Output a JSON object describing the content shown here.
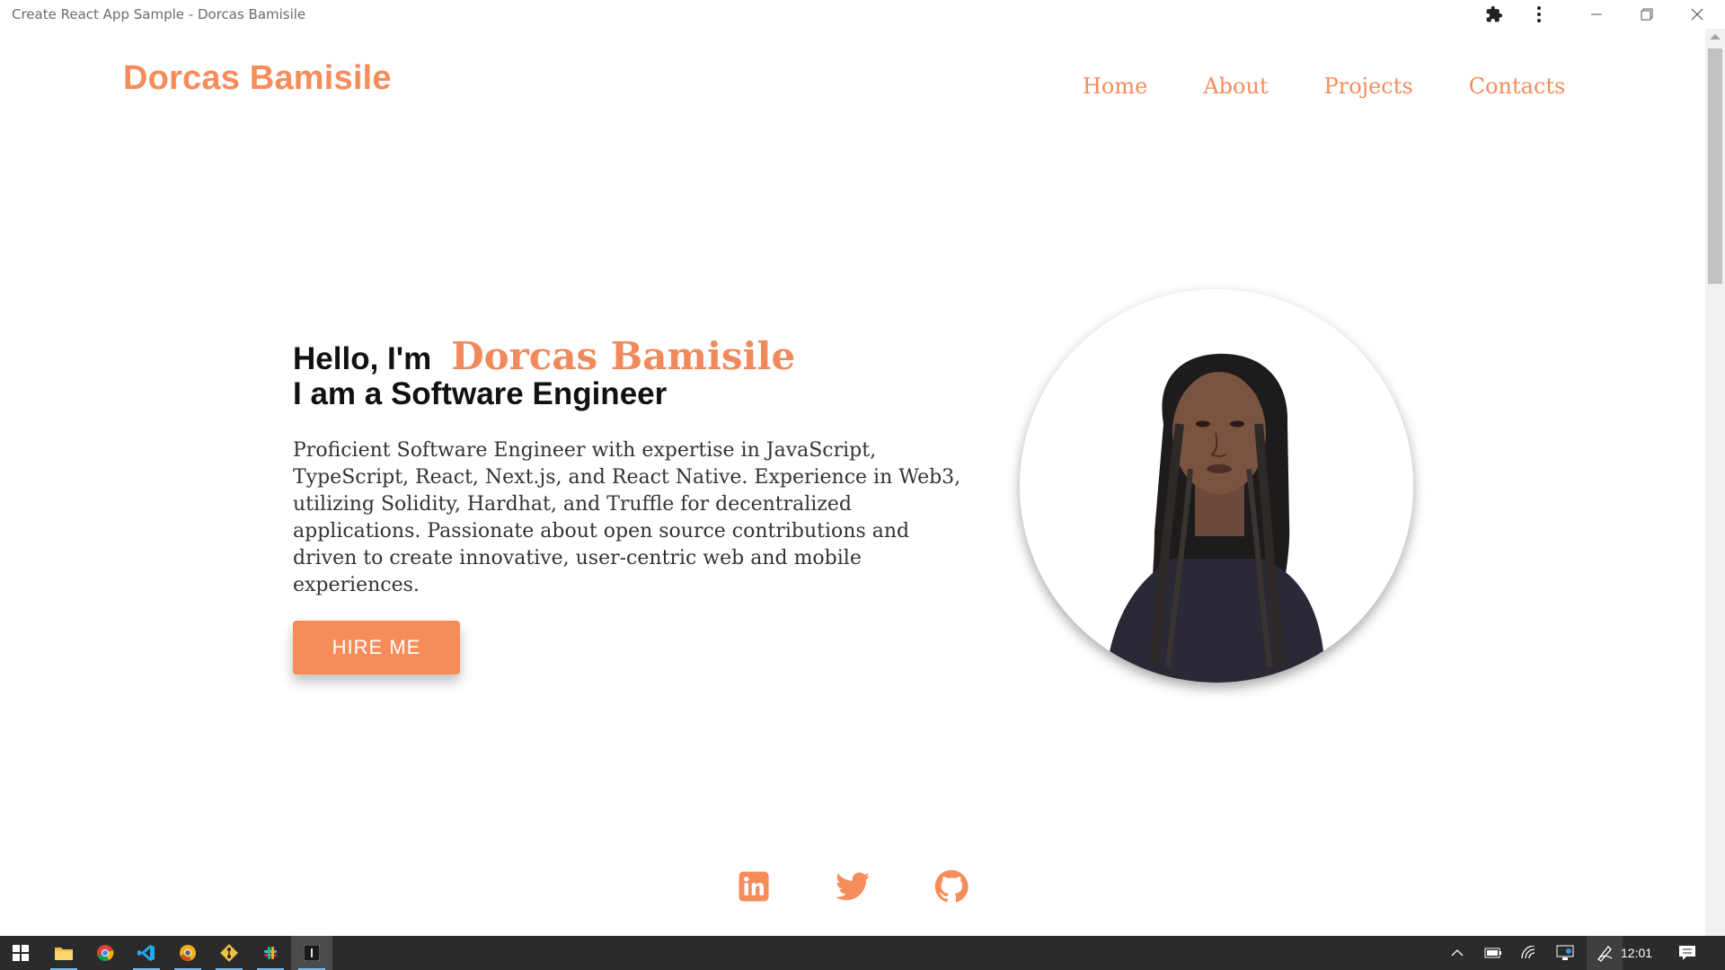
{
  "window": {
    "title": "Create React App Sample - Dorcas Bamisile",
    "extension_icon": "puzzle-icon",
    "menu_icon": "kebab-menu-icon"
  },
  "header": {
    "logo": "Dorcas Bamisile",
    "nav": [
      "Home",
      "About",
      "Projects",
      "Contacts"
    ]
  },
  "hero": {
    "greeting": "Hello, I'm",
    "name": "Dorcas Bamisile",
    "role": "I am a Software Engineer",
    "description": "Proficient Software Engineer with expertise in JavaScript, TypeScript, React, Next.js, and React Native. Experience in Web3, utilizing Solidity, Hardhat, and Truffle for decentralized applications. Passionate about open source contributions and driven to create innovative, user-centric web and mobile experiences.",
    "cta": "HIRE ME",
    "photo": "profile-photo"
  },
  "social": [
    "linkedin-icon",
    "twitter-icon",
    "github-icon"
  ],
  "taskbar": {
    "apps": [
      "windows-start-icon",
      "file-explorer-icon",
      "chrome-icon",
      "vscode-icon",
      "chrome-canary-icon",
      "git-icon",
      "slack-icon",
      "terminal-icon"
    ],
    "tray": [
      "chevron-up-icon",
      "battery-icon",
      "wifi-icon",
      "display-icon",
      "pen-icon"
    ],
    "time": "12:01",
    "notification_icon": "action-center-icon"
  },
  "colors": {
    "accent": "#f68c5a",
    "taskbar": "#2b2b2b",
    "text_dark": "#111111"
  }
}
